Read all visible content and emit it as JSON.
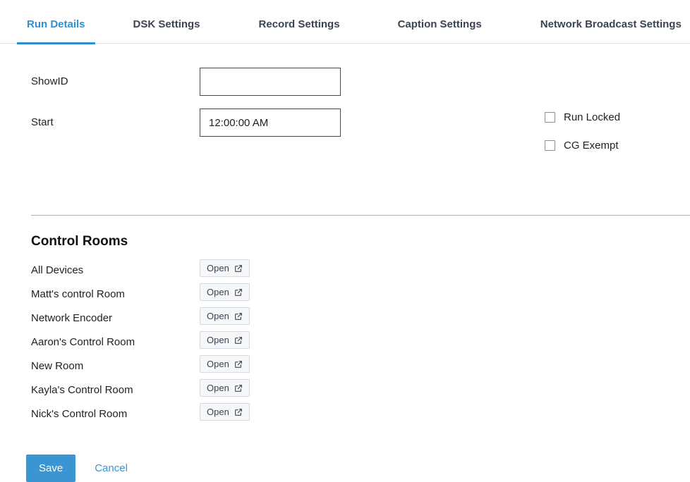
{
  "colors": {
    "accent": "#2e8fd1",
    "button_blue": "#3b95d3",
    "tab_inactive_text": "#3c4453",
    "divider": "#a9b0bb",
    "open_button_bg": "#f6f7f9",
    "open_button_border": "#d5d9e0",
    "input_border": "#4a4a4a",
    "checkbox_border": "#8a8f98",
    "page_bg": "#ffffff"
  },
  "tabs": [
    {
      "label": "Run Details",
      "active": true
    },
    {
      "label": "DSK Settings",
      "active": false
    },
    {
      "label": "Record Settings",
      "active": false
    },
    {
      "label": "Caption Settings",
      "active": false
    },
    {
      "label": "Network Broadcast Settings",
      "active": false
    }
  ],
  "form": {
    "showid": {
      "label": "ShowID",
      "value": "",
      "placeholder": ""
    },
    "start": {
      "label": "Start",
      "value": "12:00:00 AM",
      "placeholder": ""
    }
  },
  "checkboxes": [
    {
      "label": "Run Locked",
      "checked": false
    },
    {
      "label": "CG Exempt",
      "checked": false
    }
  ],
  "control_rooms": {
    "title": "Control Rooms",
    "open_label": "Open",
    "open_icon": "external-link-icon",
    "rooms": [
      {
        "name": "All Devices"
      },
      {
        "name": "Matt's control Room"
      },
      {
        "name": "Network Encoder"
      },
      {
        "name": "Aaron's Control Room"
      },
      {
        "name": "New Room"
      },
      {
        "name": "Kayla's Control Room"
      },
      {
        "name": "Nick's Control Room"
      }
    ]
  },
  "actions": {
    "save_label": "Save",
    "cancel_label": "Cancel"
  }
}
